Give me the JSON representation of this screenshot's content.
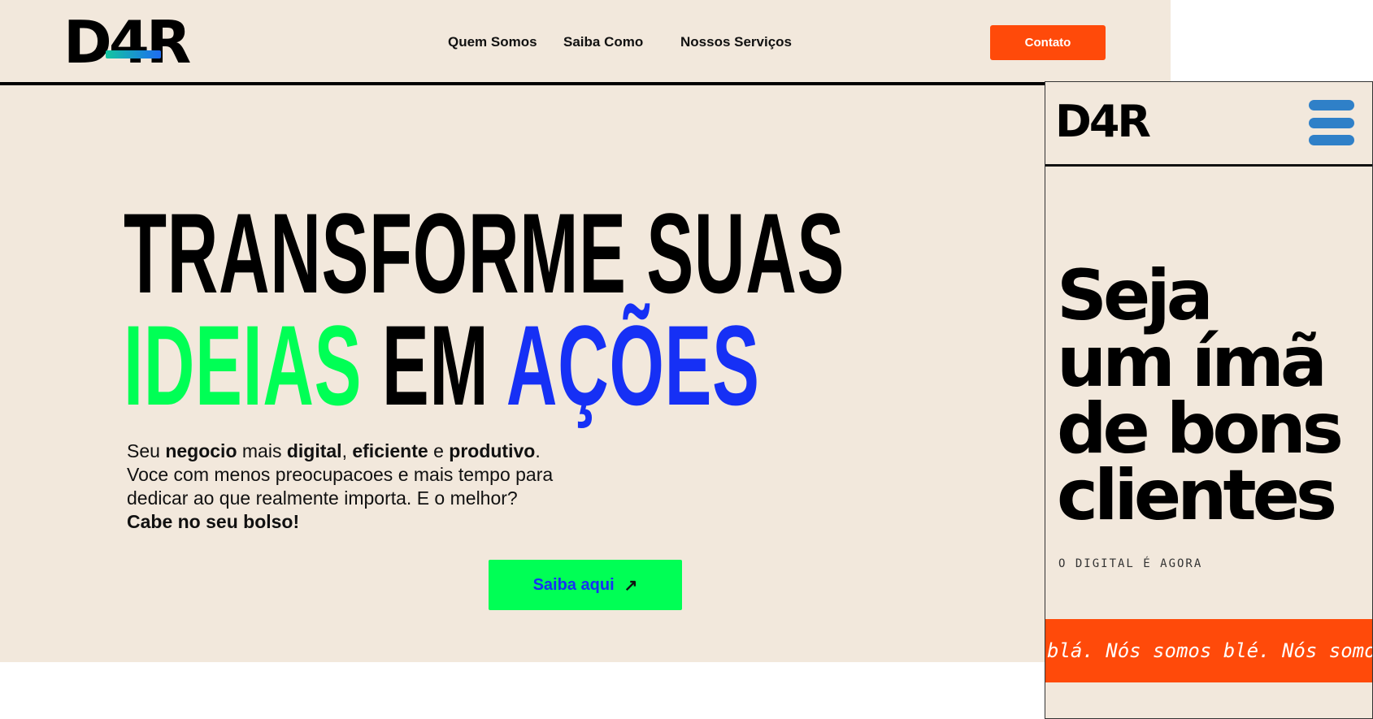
{
  "desktop": {
    "logo": {
      "d": "D",
      "four": "4",
      "r": "R"
    },
    "nav": [
      "Quem Somos",
      "Saiba Como",
      "Nossos Serviços"
    ],
    "contact_button": "Contato",
    "headline": {
      "line1": "TRANSFORME SUAS",
      "word1": "IDEIAS",
      "word2": "EM",
      "word3": "AÇÕES"
    },
    "subtext": {
      "p1": "Seu ",
      "b1": "negocio",
      "p2": " mais ",
      "b2": "digital",
      "p3": ", ",
      "b3": "eficiente",
      "p4": " e ",
      "b4": "produtivo",
      "p5": ".",
      "line2": "Voce com menos preocupacoes e mais tempo para dedicar ao que realmente importa. E o melhor?",
      "b5": "Cabe no seu bolso!"
    },
    "cta_button": "Saiba aqui",
    "cta_icon": "arrow-up-right-icon",
    "colors": {
      "background": "#f2e8dc",
      "orange": "#ff4a0a",
      "green": "#00ff55",
      "blue": "#1630f5"
    }
  },
  "mobile": {
    "logo": "D4R",
    "menu_icon": "hamburger-menu-icon",
    "title_lines": [
      "Seja",
      "um ímã",
      "de bons",
      "clientes"
    ],
    "tagline": "O DIGITAL É AGORA",
    "marquee": "blá. Nós somos blé. Nós somos bl"
  }
}
